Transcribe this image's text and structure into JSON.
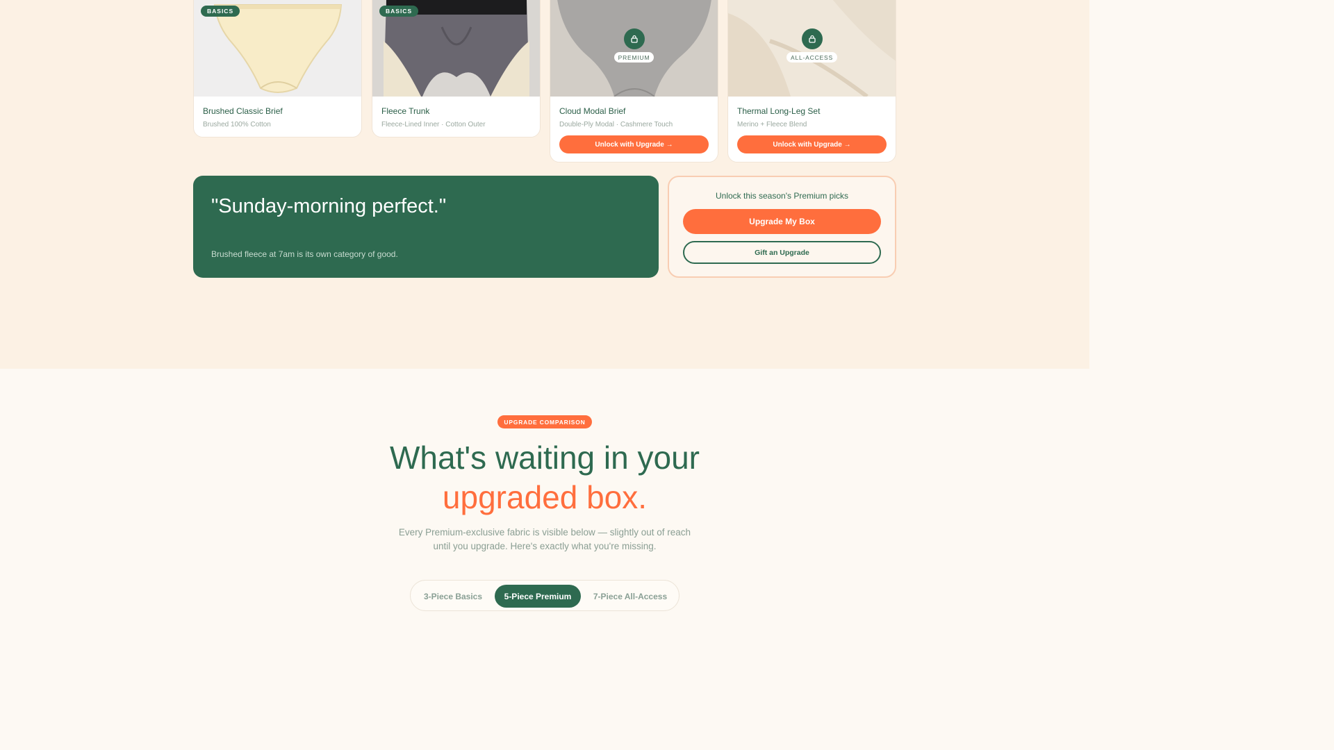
{
  "products": [
    {
      "title": "Brushed Classic Brief",
      "subtitle": "Brushed 100% Cotton",
      "tag": "BASICS",
      "locked": false,
      "illustration": "cream brief"
    },
    {
      "title": "Fleece Trunk",
      "subtitle": "Fleece-Lined Inner · Cotton Outer",
      "tag": "BASICS",
      "locked": false,
      "illustration": "grey fleece trunk"
    },
    {
      "title": "Cloud Modal Brief",
      "subtitle": "Double-Ply Modal · Cashmere Touch",
      "lock_label": "PREMIUM",
      "locked": true,
      "button": "Unlock with Upgrade →",
      "illustration": "grey modal brief"
    },
    {
      "title": "Thermal Long-Leg Set",
      "subtitle": "Merino + Fleece Blend",
      "lock_label": "ALL-ACCESS",
      "locked": true,
      "button": "Unlock with Upgrade →",
      "illustration": "cream thermal set"
    }
  ],
  "quote": {
    "text": "\"Sunday-morning perfect.\"",
    "sub": "Brushed fleece at 7am is its own category of good."
  },
  "cta": {
    "title": "Unlock this season's Premium picks",
    "primary": "Upgrade My Box",
    "secondary": "Gift an Upgrade"
  },
  "comparison": {
    "badge": "UPGRADE COMPARISON",
    "headline_line1": "What's waiting in your",
    "headline_line2": "upgraded box.",
    "desc_line1": "Every Premium-exclusive fabric is visible below — slightly out of reach",
    "desc_line2": "until you upgrade. Here's exactly what you're missing.",
    "tabs": [
      {
        "label": "3-Piece Basics",
        "active": false
      },
      {
        "label": "5-Piece Premium",
        "active": true
      },
      {
        "label": "7-Piece All-Access",
        "active": false
      }
    ]
  },
  "colors": {
    "accent": "#ff6e3d",
    "brand_green": "#2e6a50",
    "top_background": "#fcf1e4",
    "page_background": "#fdf9f3"
  },
  "icons": {
    "lock": "lock-icon"
  }
}
